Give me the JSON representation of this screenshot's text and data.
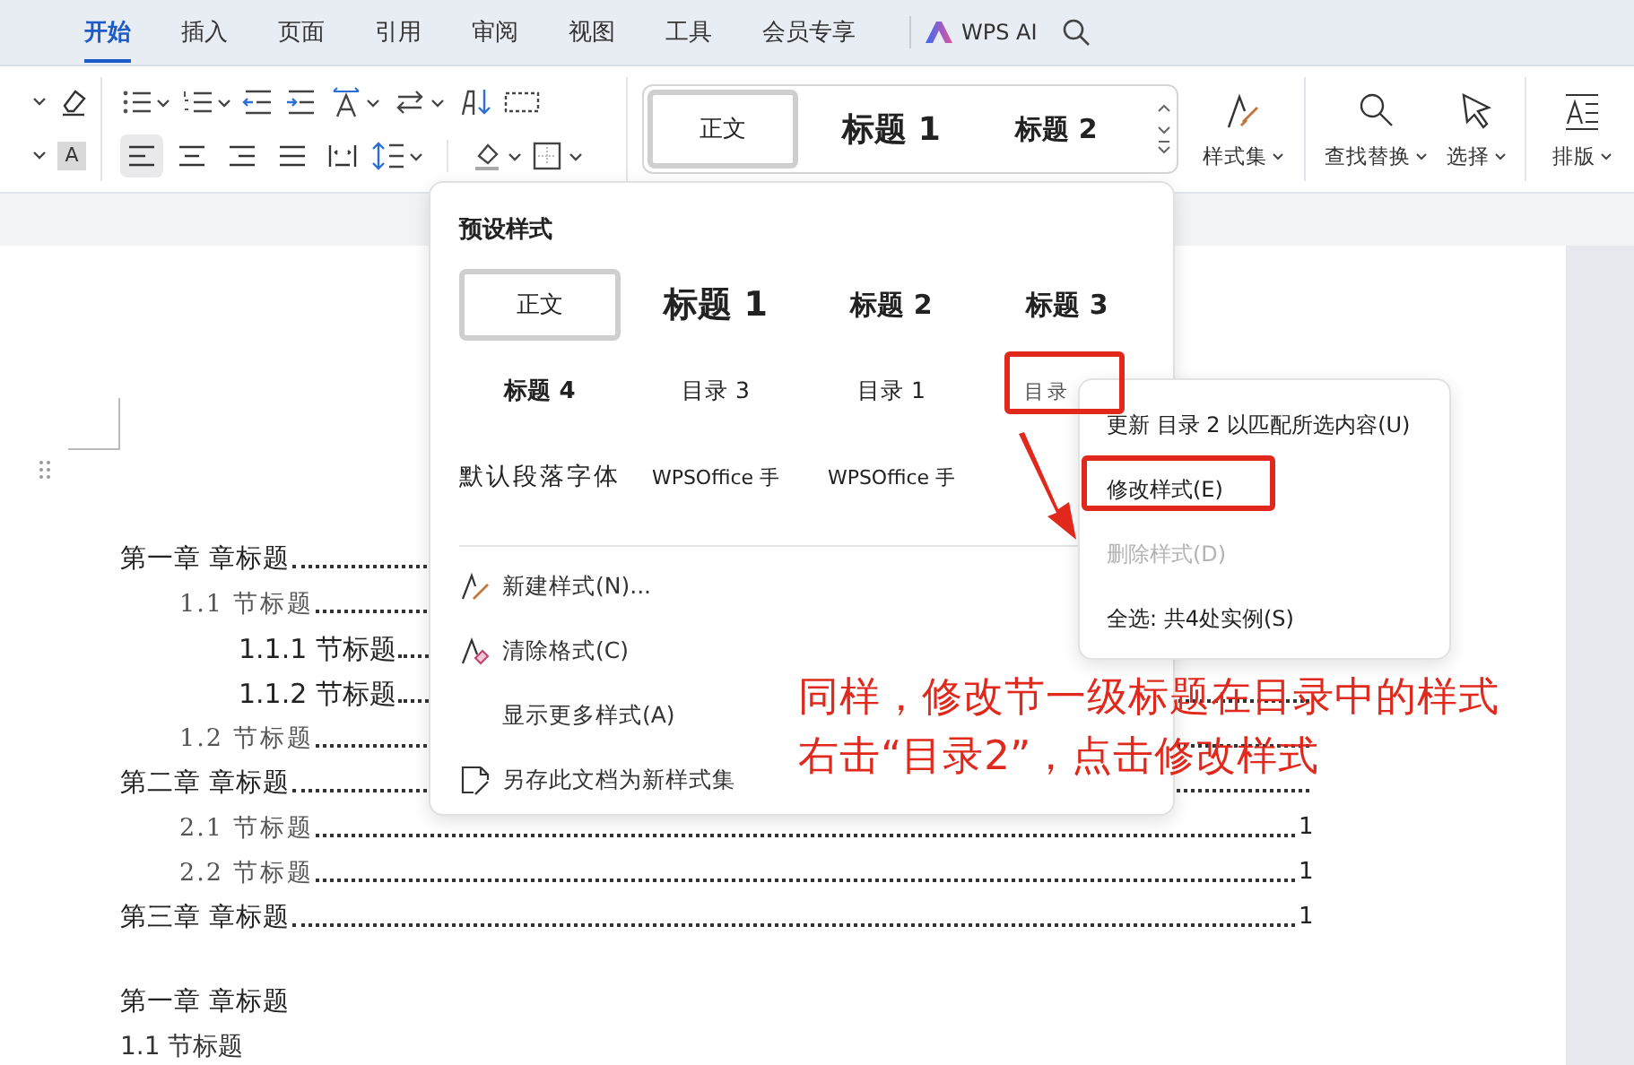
{
  "tabs": [
    {
      "label": "开始",
      "selected": true
    },
    {
      "label": "插入",
      "selected": false
    },
    {
      "label": "页面",
      "selected": false
    },
    {
      "label": "引用",
      "selected": false
    },
    {
      "label": "审阅",
      "selected": false
    },
    {
      "label": "视图",
      "selected": false
    },
    {
      "label": "工具",
      "selected": false
    },
    {
      "label": "会员专享",
      "selected": false
    }
  ],
  "ai_label": "WPS AI",
  "ribbon": {
    "highlight_letter": "A",
    "align_buttons": [
      {
        "kind": "left",
        "selected": true
      },
      {
        "kind": "center",
        "selected": false
      },
      {
        "kind": "right",
        "selected": false
      },
      {
        "kind": "justify",
        "selected": false
      },
      {
        "kind": "distributed",
        "selected": false
      }
    ],
    "styles": [
      {
        "label": "正文",
        "kind": "body",
        "selected": true
      },
      {
        "label": "标题 1",
        "kind": "h1",
        "selected": false
      },
      {
        "label": "标题 2",
        "kind": "h2",
        "selected": false
      }
    ],
    "buttons": [
      {
        "label": "样式集",
        "kind": "styles"
      },
      {
        "label": "查找替换",
        "kind": "find"
      },
      {
        "label": "选择",
        "kind": "select"
      },
      {
        "label": "排版",
        "kind": "layout"
      }
    ]
  },
  "document": {
    "toc": [
      {
        "text": "第一章 章标题",
        "children": [
          {
            "text": "1.1 节标题",
            "children": [
              {
                "text": "1.1.1 节标题"
              },
              {
                "text": "1.1.2 节标题"
              }
            ]
          },
          {
            "text": "1.2 节标题"
          }
        ]
      },
      {
        "text": "第二章 章标题",
        "children": [
          {
            "text": "2.1 节标题",
            "page": "1"
          },
          {
            "text": "2.2 节标题",
            "page": "1"
          }
        ]
      },
      {
        "text": "第三章 章标题",
        "page": "1"
      }
    ],
    "body": [
      {
        "text": "第一章 章标题",
        "kind": "chapter"
      },
      {
        "text": "1.1 节标题",
        "kind": "section"
      }
    ]
  },
  "styles_popup": {
    "title": "预设样式",
    "styles": [
      {
        "label": "正文",
        "kind": "body",
        "selected": true
      },
      {
        "label": "标题 1",
        "kind": "h1",
        "selected": false
      },
      {
        "label": "标题 2",
        "kind": "h2",
        "selected": false
      },
      {
        "label": "标题 3",
        "kind": "h3",
        "selected": false
      },
      {
        "label": "标题 4",
        "kind": "h4",
        "selected": false
      },
      {
        "label": "目录 3",
        "kind": "toc",
        "selected": false
      },
      {
        "label": "目录 1",
        "kind": "toc",
        "selected": false
      },
      {
        "label": "目录",
        "kind": "toc2",
        "selected": false
      },
      {
        "label": "默认段落字体",
        "kind": "plain",
        "selected": false
      },
      {
        "label": "WPSOffice 手",
        "kind": "font",
        "selected": false
      },
      {
        "label": "WPSOffice 手",
        "kind": "font",
        "selected": false
      }
    ],
    "actions": [
      {
        "label": "新建样式(N)...",
        "kind": "new"
      },
      {
        "label": "清除格式(C)",
        "kind": "clear"
      },
      {
        "label": "显示更多样式(A)",
        "kind": "more"
      },
      {
        "label": "另存此文档为新样式集",
        "kind": "save"
      }
    ]
  },
  "context_menu": {
    "items": [
      {
        "label": "更新 目录 2 以匹配所选内容(U)",
        "disabled": false
      },
      {
        "label": "修改样式(E)",
        "disabled": false
      },
      {
        "label": "删除样式(D)",
        "disabled": true
      },
      {
        "label": "全选: 共4处实例(S)",
        "disabled": false
      }
    ]
  },
  "annotation": {
    "lines": [
      "同样，修改节一级标题在目录中的样式",
      "右击“目录2”，点击修改样式"
    ]
  }
}
